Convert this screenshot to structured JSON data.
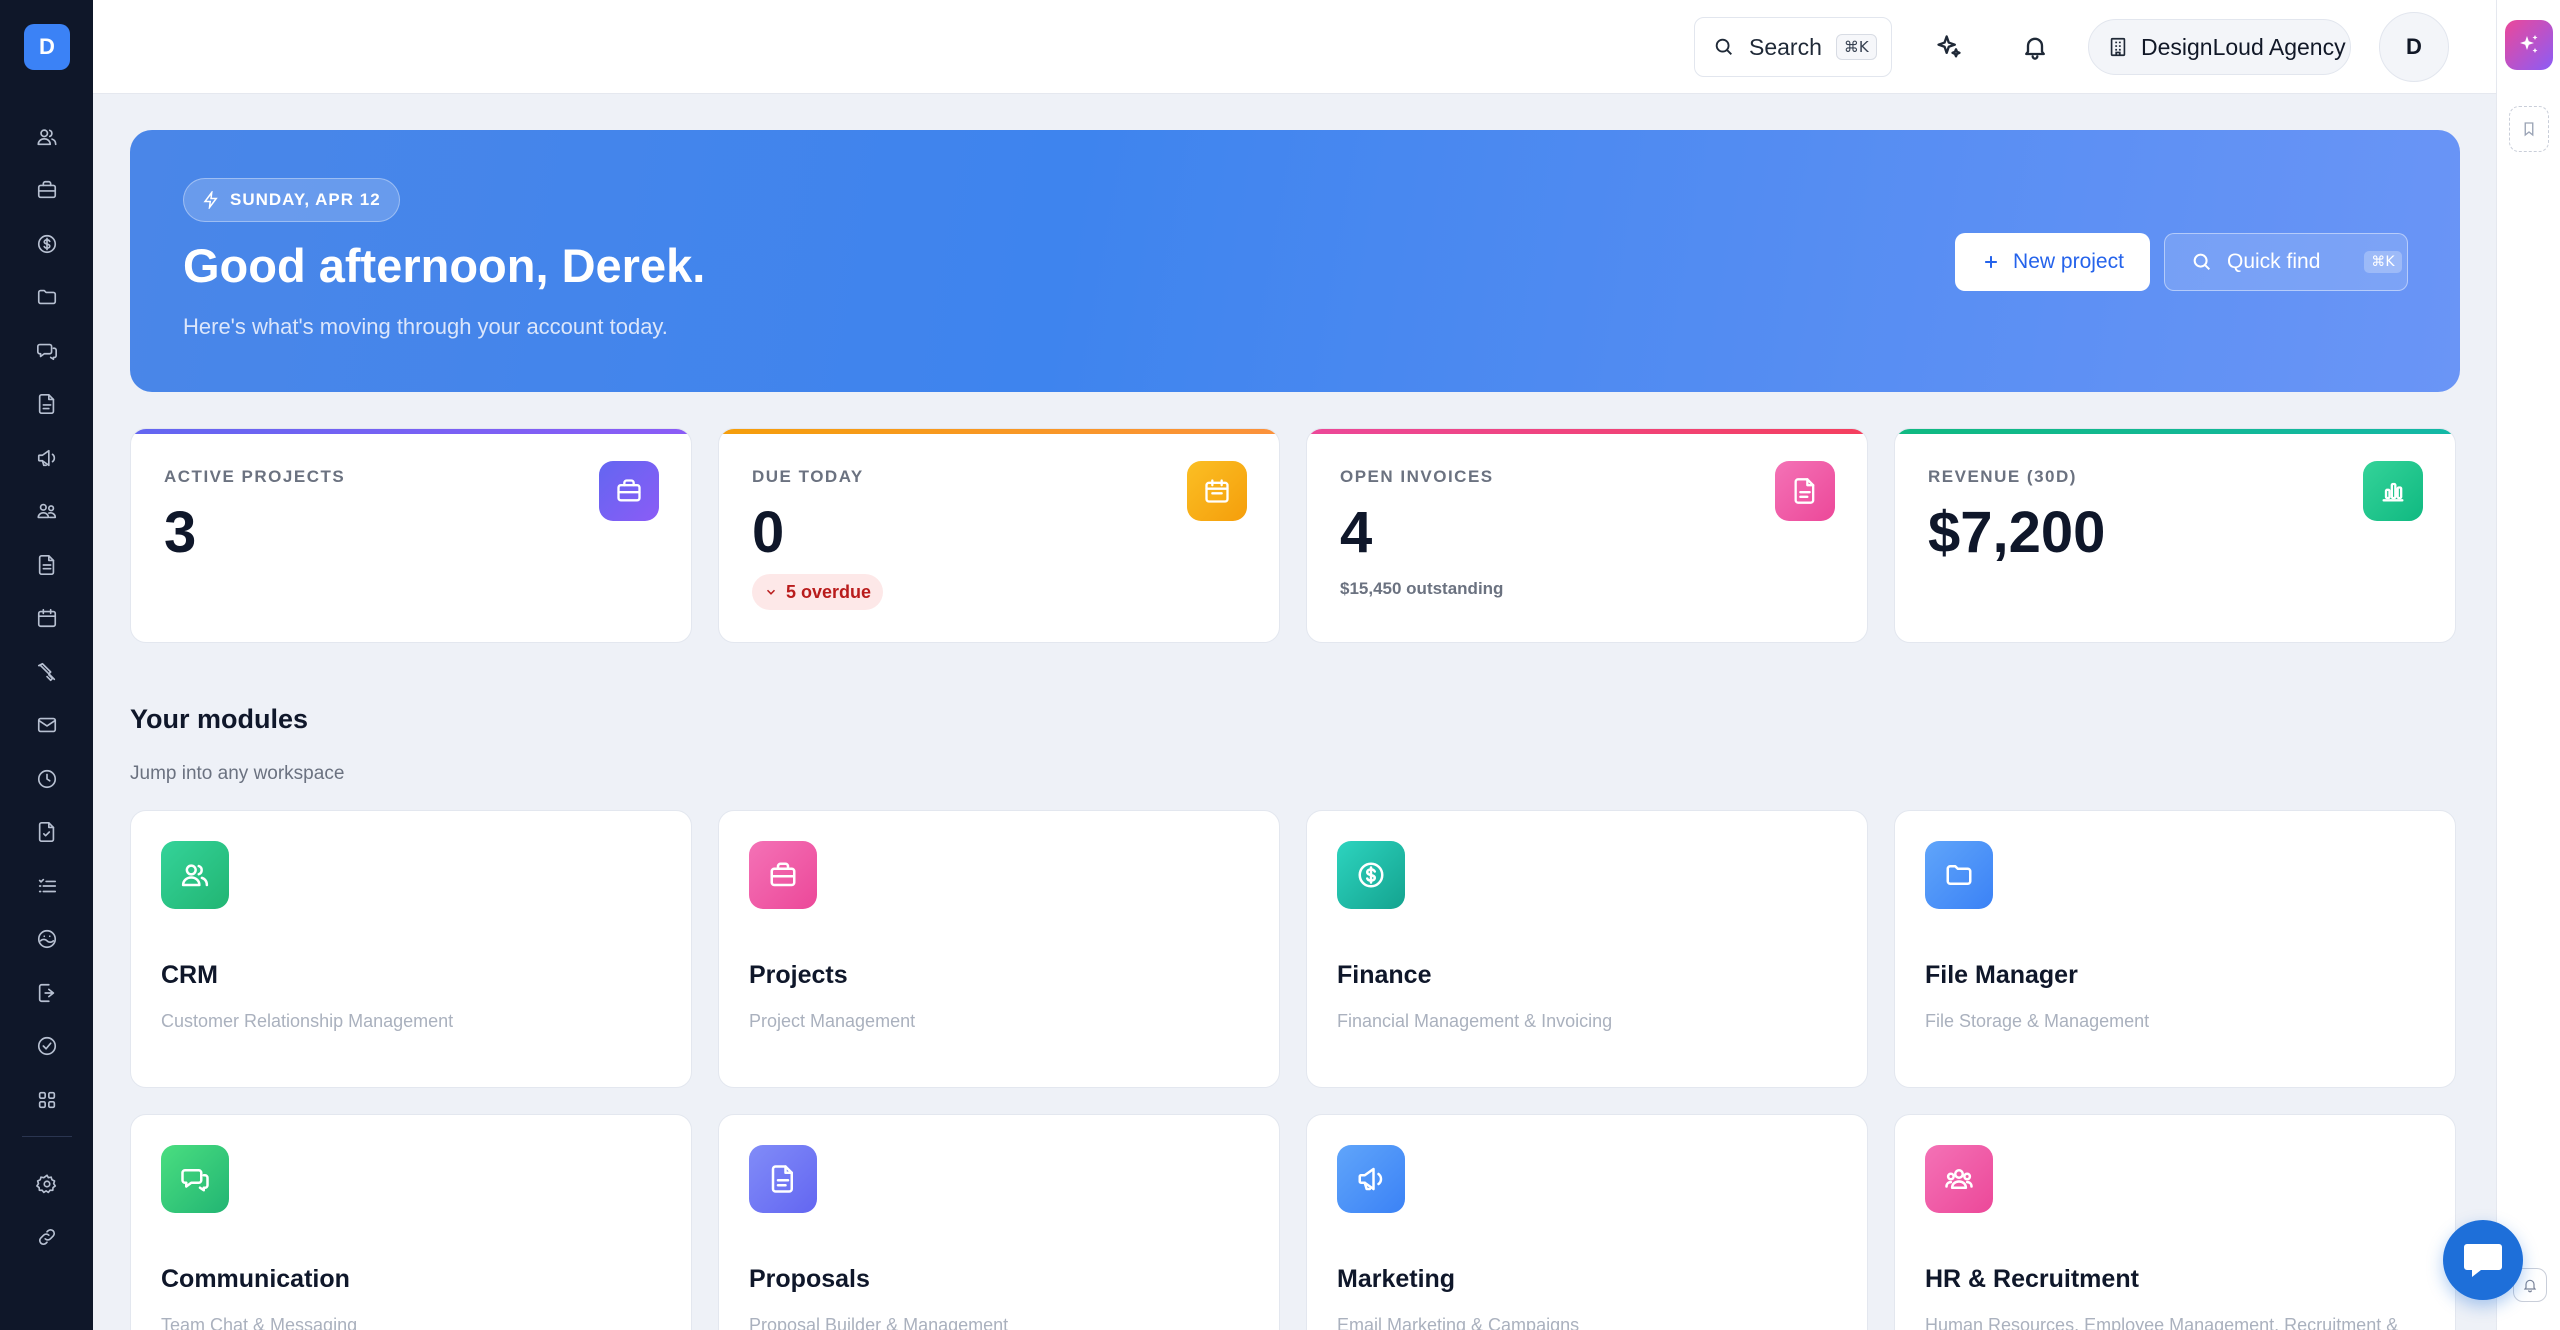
{
  "sidebar": {
    "logo_letter": "D",
    "items": [
      {
        "icon": "users-icon"
      },
      {
        "icon": "briefcase-icon"
      },
      {
        "icon": "dollar-icon"
      },
      {
        "icon": "folder-icon"
      },
      {
        "icon": "chat-icon"
      },
      {
        "icon": "document-icon"
      },
      {
        "icon": "megaphone-icon"
      },
      {
        "icon": "team-icon"
      },
      {
        "icon": "invoice-icon"
      },
      {
        "icon": "calendar-icon"
      },
      {
        "icon": "tools-icon"
      },
      {
        "icon": "mail-icon"
      },
      {
        "icon": "clock-icon"
      },
      {
        "icon": "checklist-icon"
      },
      {
        "icon": "tasks-icon"
      },
      {
        "icon": "support-icon"
      },
      {
        "icon": "export-icon"
      },
      {
        "icon": "check-circle-icon"
      },
      {
        "icon": "apps-grid-icon"
      }
    ],
    "bottom": [
      {
        "icon": "gear-icon"
      },
      {
        "icon": "link-icon"
      }
    ]
  },
  "header": {
    "search_label": "Search",
    "search_shortcut": "⌘K",
    "org_name": "DesignLoud Agency",
    "avatar_letter": "D"
  },
  "hero": {
    "date": "SUNDAY, APR 12",
    "greeting": "Good afternoon, Derek.",
    "subtitle": "Here's what's moving through your account today.",
    "new_project": "New project",
    "quick_find": "Quick find",
    "quick_find_shortcut": "⌘K"
  },
  "stats": [
    {
      "label": "ACTIVE PROJECTS",
      "value": "3",
      "color": "#6366f1"
    },
    {
      "label": "DUE TODAY",
      "value": "0",
      "badge": "5 overdue",
      "color": "#f59e0b"
    },
    {
      "label": "OPEN INVOICES",
      "value": "4",
      "note": "$15,450 outstanding",
      "color": "#ec4899"
    },
    {
      "label": "REVENUE (30D)",
      "value": "$7,200",
      "color": "#10b981"
    }
  ],
  "modules": {
    "title": "Your modules",
    "subtitle": "Jump into any workspace",
    "items": [
      {
        "name": "CRM",
        "desc": "Customer Relationship Management",
        "color": "#34c38f"
      },
      {
        "name": "Projects",
        "desc": "Project Management",
        "color": "#ec4899"
      },
      {
        "name": "Finance",
        "desc": "Financial Management & Invoicing",
        "color": "#14b8a6"
      },
      {
        "name": "File Manager",
        "desc": "File Storage & Management",
        "color": "#3b82f6"
      },
      {
        "name": "Communication",
        "desc": "Team Chat & Messaging",
        "color": "#22c55e"
      },
      {
        "name": "Proposals",
        "desc": "Proposal Builder & Management",
        "color": "#6366f1"
      },
      {
        "name": "Marketing",
        "desc": "Email Marketing & Campaigns",
        "color": "#3b82f6"
      },
      {
        "name": "HR & Recruitment",
        "desc": "Human Resources, Employee Management, Recruitment &",
        "color": "#ec4899"
      }
    ]
  }
}
